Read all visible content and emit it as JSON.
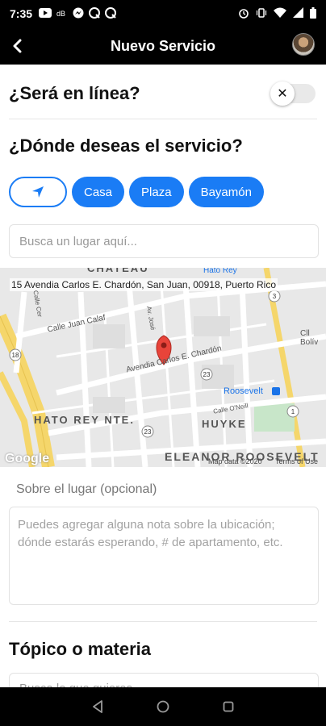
{
  "status_bar": {
    "time": "7:35",
    "left_icons": [
      "youtube-icon",
      "data-saver-icon",
      "messenger-icon",
      "q-app-icon",
      "q-app-icon"
    ],
    "right_icons": [
      "alarm-icon",
      "vibrate-icon",
      "wifi-icon",
      "signal-icon",
      "battery-icon"
    ]
  },
  "app_bar": {
    "title": "Nuevo Servicio",
    "back_icon": "back-arrow-icon",
    "avatar_icon": "user-avatar"
  },
  "online": {
    "label": "¿Será en línea?",
    "toggle_on": false,
    "toggle_glyph": "✕"
  },
  "location": {
    "heading": "¿Dónde deseas el servicio?",
    "chips": [
      {
        "icon": "navigation-arrow-icon",
        "label": ""
      },
      {
        "label": "Casa"
      },
      {
        "label": "Plaza"
      },
      {
        "label": "Bayamón"
      }
    ],
    "search_placeholder": "Busca un lugar aquí..."
  },
  "map": {
    "address": "15 Avendia Carlos E. Chardón, San Juan, 00918, Puerto Rico",
    "areas": [
      "CHATEAU",
      "HATO REY NTE.",
      "HUYKE",
      "ELEANOR ROOSEVELT"
    ],
    "streets": [
      "Calle Juan Calaf",
      "Avendia Carlos E. Chardón",
      "Calle O'Neill",
      "Av. José",
      "Calle Cer",
      "Cll Bolív",
      "Hato Rey"
    ],
    "poi": "Roosevelt",
    "route_shields": [
      "18",
      "23",
      "1",
      "23",
      "3"
    ],
    "attribution": "Google",
    "map_data": "Map data ©2020",
    "terms": "Terms of Use",
    "accent": "#e8443a"
  },
  "notes": {
    "label": "Sobre el lugar (opcional)",
    "placeholder": "Puedes agregar alguna nota sobre la ubicación; dónde estarás esperando, # de apartamento, etc."
  },
  "topic": {
    "heading": "Tópico o materia",
    "placeholder": "Busca lo que quieres..."
  },
  "nav": {
    "icons": [
      "back-triangle-icon",
      "home-circle-icon",
      "recents-square-icon"
    ]
  },
  "colors": {
    "accent": "#1a7cf5",
    "header_bg": "#000000"
  }
}
